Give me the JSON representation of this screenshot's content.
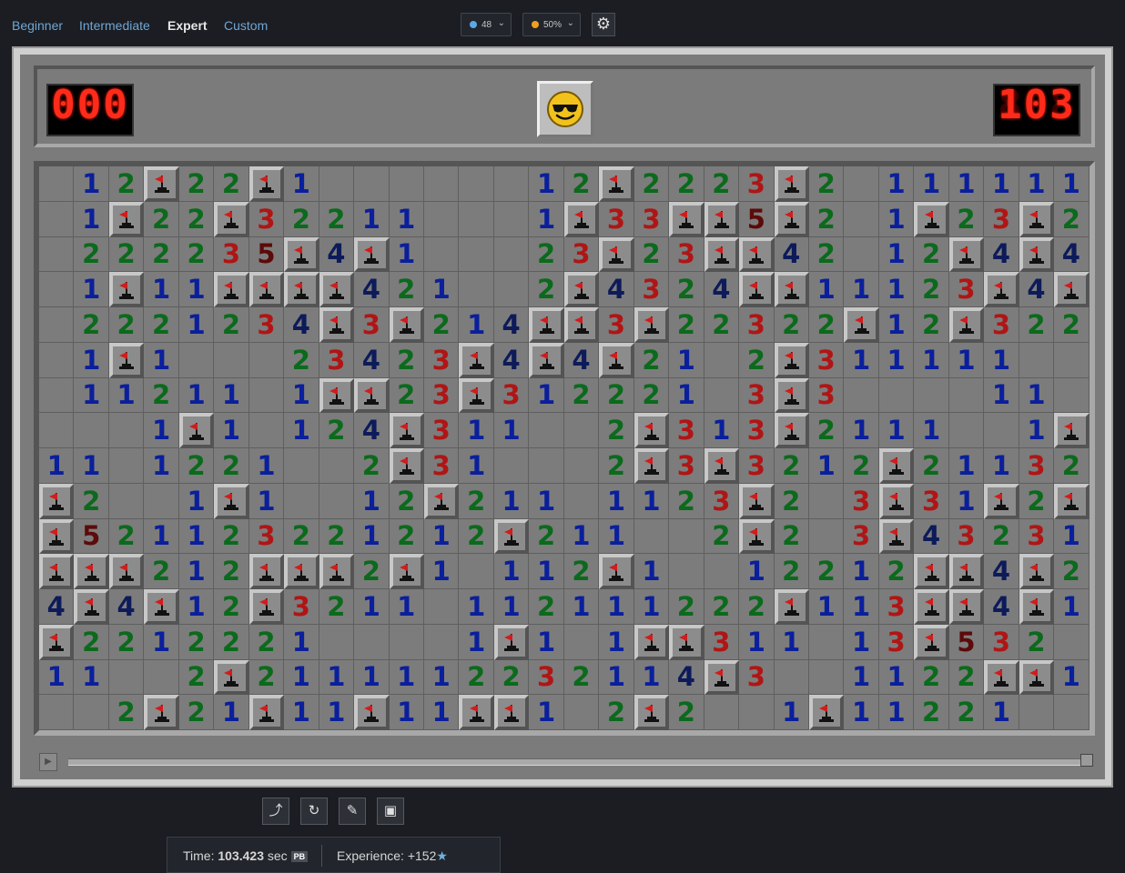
{
  "nav": {
    "difficulties": [
      {
        "label": "Beginner",
        "active": false
      },
      {
        "label": "Intermediate",
        "active": false
      },
      {
        "label": "Expert",
        "active": true
      },
      {
        "label": "Custom",
        "active": false
      }
    ]
  },
  "controls": {
    "zoom_value": "48",
    "zoom_icon": "zoom-icon",
    "speed_value": "50%",
    "speed_icon": "speed-dot-icon",
    "settings_icon": "gear-icon"
  },
  "game": {
    "mines_left": "000",
    "timer": "103",
    "face": "cool-face-icon",
    "rows": [
      "_12F22F1______12F22 23F2_111111_",
      "_1F22F32211___1F33FF5F2_1F23F2_",
      "_22223 5F4F1___23F23FF42_12F4F42",
      "_1F11FFFF421__2F432 4FF111 23F4FF",
      "_222123 4F3F21 4FF3F22322F12F322",
      "_1F1___234 23F4F4F21_2F311111__",
      "_112 11_1FF23F312221_3F3____11",
      "___1F1_124F311__2F313F2111__1F",
      "11_1221__2F31___2F3F3212F2113 2",
      "F2__1F1__12F211_112 3F2_3F31F2F",
      "F5 2112322121 2F211__2F2_3F4323 1",
      "FFF212FFF2F1_112F1__1221 2FF4F21",
      "4F4F12F32 11_1121112 22F113FF4F1",
      "F2212221____1F1_1FF311_13F53 2",
      "11__2F211111223211 4F3__112 2FF1",
      "__2F21F11F11FF1_2F2__1F1122 1"
    ]
  }
}
